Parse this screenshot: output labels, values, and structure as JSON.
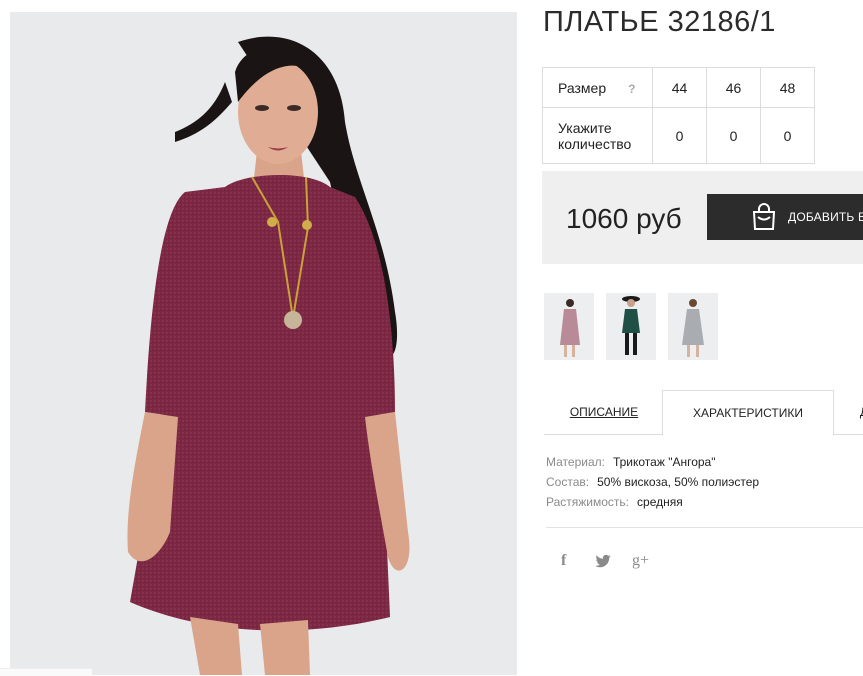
{
  "product": {
    "title": "ПЛАТЬЕ 32186/1",
    "main_image_alt": "dress-model-photo"
  },
  "sizes": {
    "size_label": "Размер",
    "help_label": "?",
    "qty_label_1": "Укажите",
    "qty_label_2": "количество",
    "values": [
      "44",
      "46",
      "48"
    ],
    "quantities": [
      "0",
      "0",
      "0"
    ]
  },
  "price": {
    "amount": "1060 руб",
    "cart_button": "ДОБАВИТЬ В КОРЗИНУ"
  },
  "thumbnails": [
    {
      "color": "#b98a97",
      "bg": "#eceef0"
    },
    {
      "color": "#1f4f45",
      "bg": "#eceef0"
    },
    {
      "color": "#a9adb2",
      "bg": "#eceef0"
    }
  ],
  "tabs": {
    "description": "ОПИСАНИЕ",
    "characteristics": "ХАРАКТЕРИСТИКИ",
    "third": "Д"
  },
  "specs": [
    {
      "key": "Материал:",
      "value": "Трикотаж \"Ангора\""
    },
    {
      "key": "Состав:",
      "value": "50% вискоза, 50% полиэстер"
    },
    {
      "key": "Растяжимость:",
      "value": "средняя"
    }
  ],
  "social": {
    "facebook": "f",
    "twitter": "twitter-icon",
    "google_plus": "g+"
  },
  "colors": {
    "dress": "#7a2541",
    "button_bg": "#2c2c2c",
    "price_bg": "#efefef"
  }
}
